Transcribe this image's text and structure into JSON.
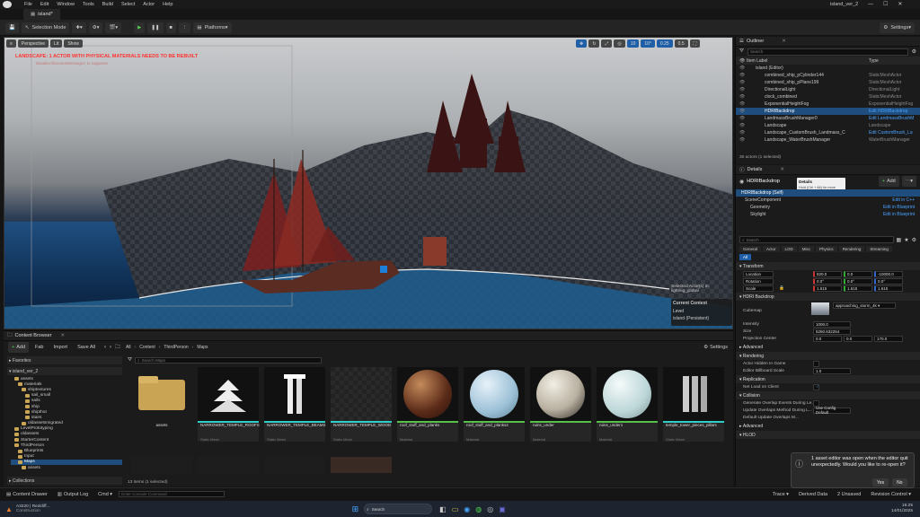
{
  "menu": [
    "File",
    "Edit",
    "Window",
    "Tools",
    "Build",
    "Select",
    "Actor",
    "Help"
  ],
  "window_title": "island_ver_2",
  "level_tab": "island*",
  "toolbar": {
    "mode": "Selection Mode",
    "platforms": "Platforms",
    "settings": "Settings"
  },
  "viewport": {
    "view_buttons": [
      "Perspective",
      "Lit",
      "Show"
    ],
    "warning": "LANDSCAPE: 1 ACTOR WITH PHYSICAL MATERIALS NEEDS TO BE REBUILT",
    "warning_sub": "'DisableAllScreenMessages' to suppress",
    "snap_values": [
      "10",
      "10°",
      "0.25",
      "0.5"
    ],
    "selected_info": "Selected Actor(s) in: lighting_global",
    "current_context": "Current Context",
    "level_label": "Level",
    "level_value": "island (Persistent)"
  },
  "outliner": {
    "title": "Outliner",
    "search_placeholder": "Search",
    "col_label": "Item Label",
    "col_type": "Type",
    "rows": [
      {
        "label": "island (Editor)",
        "type": ""
      },
      {
        "label": "combined_ship_pCylinder144",
        "type": "StaticMeshActor"
      },
      {
        "label": "combined_ship_pPlane199",
        "type": "StaticMeshActor"
      },
      {
        "label": "DirectionalLight",
        "type": "DirectionalLight"
      },
      {
        "label": "clock_combined",
        "type": "StaticMeshActor"
      },
      {
        "label": "ExponentialHeightFog",
        "type": "ExponentialHeightFog"
      },
      {
        "label": "HDRIBackdrop",
        "type": "Edit HDRIBackdrop"
      },
      {
        "label": "LandmassBrushManager0",
        "type": "Edit LandmassBrushM"
      },
      {
        "label": "Landscape",
        "type": "Landscape"
      },
      {
        "label": "Landscape_CustomBrush_Landmass_C",
        "type": "Edit CustomBrush_La"
      },
      {
        "label": "Landscape_WaterBrushManager",
        "type": "WaterBrushManager"
      }
    ],
    "count": "30 actors (1 selected)"
  },
  "details": {
    "title": "Details",
    "actor": "HDRIBackdrop",
    "add": "Add",
    "tooltip_title": "Details",
    "tooltip_sub": "Hold (Ctrl + Alt) for more",
    "components": [
      {
        "label": "HDRIBackdrop (Self)",
        "link": ""
      },
      {
        "label": "SceneComponent",
        "link": "Edit in C++"
      },
      {
        "label": "Geometry",
        "link": "Edit in Blueprint"
      },
      {
        "label": "Skylight",
        "link": "Edit in Blueprint"
      }
    ],
    "search_placeholder": "Search",
    "filter_tabs": [
      "General",
      "Actor",
      "LOD",
      "Misc",
      "Physics",
      "Rendering",
      "Streaming"
    ],
    "all_tab": "All",
    "transform": "Transform",
    "location": {
      "label": "Location",
      "x": "820.0",
      "y": "0.0",
      "z": "-10000.0"
    },
    "rotation": {
      "label": "Rotation",
      "x": "0.0°",
      "y": "0.0°",
      "z": "0.0°"
    },
    "scale": {
      "label": "Scale",
      "x": "1.615",
      "y": "1.615",
      "z": "1.615"
    },
    "hdri_section": "HDRI Backdrop",
    "cubemap_label": "Cubemap",
    "cubemap_value": "approaching_storm_4k",
    "intensity_label": "Intensity",
    "intensity_value": "1000.0",
    "size_label": "Size",
    "size_value": "5250.632254",
    "proj_label": "Projection Center",
    "proj_x": "0.0",
    "proj_y": "0.0",
    "proj_z": "170.0",
    "advanced": "Advanced",
    "rendering": "Rendering",
    "hidden_label": "Actor Hidden In Game",
    "billboard_label": "Editor Billboard Scale",
    "billboard_value": "1.0",
    "replication": "Replication",
    "net_load": "Net Load on Client",
    "collision": "Collision",
    "gen_overlap": "Generate Overlap Events During Le...",
    "update_overlap": "Update Overlaps Method During L...",
    "update_value": "Use Config Default",
    "default_overlap": "Default Update Overlaps M...",
    "advanced2": "Advanced",
    "hlod": "HLOD"
  },
  "content_browser": {
    "title": "Content Browser",
    "add": "Add",
    "fab": "Fab",
    "import": "Import",
    "save_all": "Save All",
    "path": [
      "All",
      "Content",
      "ThirdPerson",
      "Maps"
    ],
    "settings": "Settings",
    "search_placeholder": "Search Maps",
    "favorites": "Favorites",
    "project": "island_ver_2",
    "tree": [
      "assets",
      "materials",
      "shiptextures",
      "sail_small",
      "sails",
      "ship",
      "shipthot",
      "stairs",
      "oldassetsmigrated",
      "LevelPrototyping",
      "oldassets",
      "StarterContent",
      "ThirdPerson",
      "Blueprints",
      "Input",
      "Maps",
      "assets"
    ],
    "collections": "Collections",
    "status": "13 items (1 selected)",
    "assets": [
      {
        "name": "assets",
        "kind": ""
      },
      {
        "name": "NARROWER_TEMPLE_ROOFS",
        "kind": "Static Mesh"
      },
      {
        "name": "NARROWER_TEMPLE_BEAMS",
        "kind": "Static Mesh"
      },
      {
        "name": "NARROWER_TEMPLE_WOOD",
        "kind": "Static Mesh"
      },
      {
        "name": "roof_stuff_and_planks",
        "kind": "Material"
      },
      {
        "name": "roof_stuff_and_planks2",
        "kind": "Material"
      },
      {
        "name": "ruins_under",
        "kind": "Material"
      },
      {
        "name": "ruins_under1",
        "kind": "Material"
      },
      {
        "name": "temple_tower_pieces_pillars",
        "kind": "Static Mesh"
      }
    ]
  },
  "statusbar": {
    "drawer": "Content Drawer",
    "output": "Output Log",
    "cmd": "Cmd",
    "console_placeholder": "Enter Console Command",
    "trace": "Trace",
    "derived": "Derived Data",
    "unsaved": "2 Unsaved",
    "revision": "Revision Control"
  },
  "toast": {
    "text": "1 asset editor was open when the editor quit unexpectedly. Would you like to re-open it?",
    "yes": "Yes",
    "no": "No"
  },
  "taskbar": {
    "news_line1": "A3220 | Redcliff...",
    "news_line2": "Construction",
    "search": "Search",
    "time": "16:25",
    "date": "14/01/2025"
  },
  "colors": {
    "accent": "#0070e0",
    "selected": "#1f4e7e",
    "warning": "#ff3333",
    "folder": "#c9a455"
  }
}
